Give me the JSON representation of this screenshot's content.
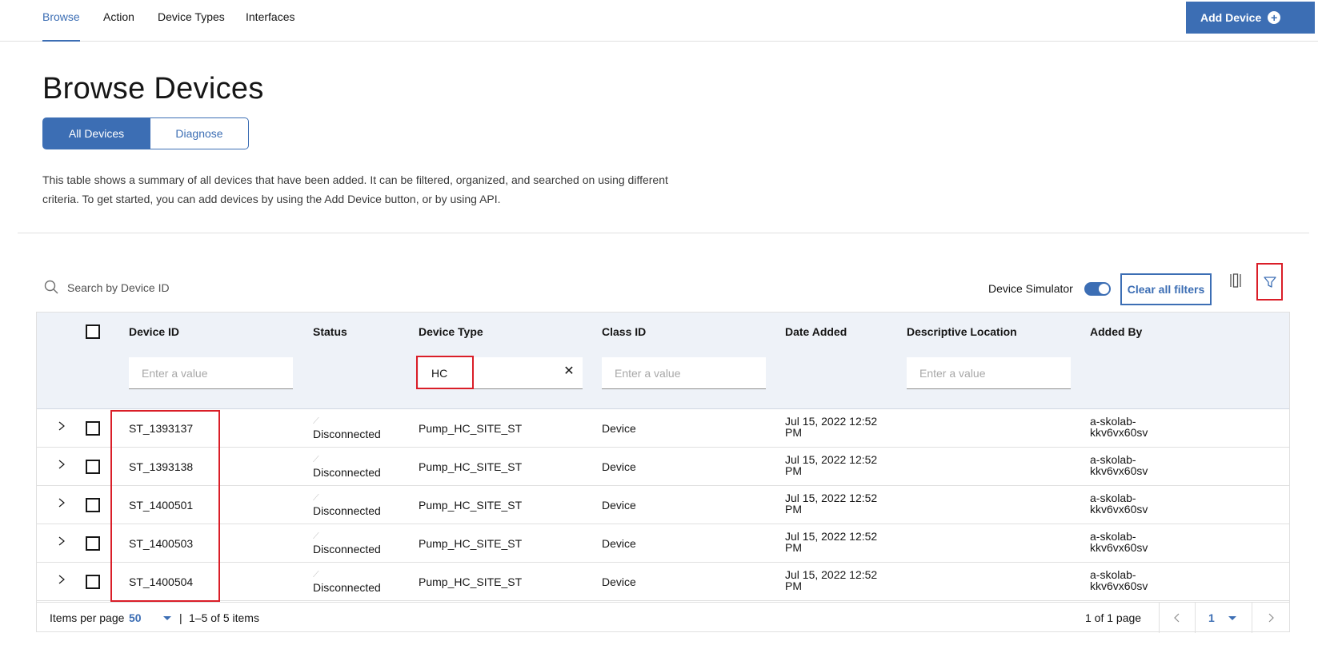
{
  "nav": {
    "tabs": [
      "Browse",
      "Action",
      "Device Types",
      "Interfaces"
    ],
    "add_device_label": "Add Device"
  },
  "page": {
    "title": "Browse Devices",
    "segments": [
      "All Devices",
      "Diagnose"
    ],
    "description": "This table shows a summary of all devices that have been added. It can be filtered, organized, and searched on using different criteria. To get started, you can add devices by using the Add Device button, or by using API."
  },
  "toolbar": {
    "search_placeholder": "Search by Device ID",
    "simulator_label": "Device Simulator",
    "clear_filters_label": "Clear all filters"
  },
  "table": {
    "headers": [
      "Device ID",
      "Status",
      "Device Type",
      "Class ID",
      "Date Added",
      "Descriptive Location",
      "Added By"
    ],
    "filter_placeholder": "Enter a value",
    "device_type_filter_value": "HC",
    "rows": [
      {
        "id": "ST_1393137",
        "status": "Disconnected",
        "type": "Pump_HC_SITE_ST",
        "class": "Device",
        "date_line1": "Jul 15, 2022 12:52",
        "date_line2": "PM",
        "added_line1": "a-skolab-",
        "added_line2": "kkv6vx60sv"
      },
      {
        "id": "ST_1393138",
        "status": "Disconnected",
        "type": "Pump_HC_SITE_ST",
        "class": "Device",
        "date_line1": "Jul 15, 2022 12:52",
        "date_line2": "PM",
        "added_line1": "a-skolab-",
        "added_line2": "kkv6vx60sv"
      },
      {
        "id": "ST_1400501",
        "status": "Disconnected",
        "type": "Pump_HC_SITE_ST",
        "class": "Device",
        "date_line1": "Jul 15, 2022 12:52",
        "date_line2": "PM",
        "added_line1": "a-skolab-",
        "added_line2": "kkv6vx60sv"
      },
      {
        "id": "ST_1400503",
        "status": "Disconnected",
        "type": "Pump_HC_SITE_ST",
        "class": "Device",
        "date_line1": "Jul 15, 2022 12:52",
        "date_line2": "PM",
        "added_line1": "a-skolab-",
        "added_line2": "kkv6vx60sv"
      },
      {
        "id": "ST_1400504",
        "status": "Disconnected",
        "type": "Pump_HC_SITE_ST",
        "class": "Device",
        "date_line1": "Jul 15, 2022 12:52",
        "date_line2": "PM",
        "added_line1": "a-skolab-",
        "added_line2": "kkv6vx60sv"
      }
    ]
  },
  "pagination": {
    "items_per_page_label": "Items per page",
    "items_per_page_value": "50",
    "separator": "|",
    "range_text": "1–5 of 5 items",
    "page_text": "1 of 1 page",
    "current_page": "1"
  },
  "colors": {
    "accent": "#3c6eb4",
    "highlight": "#da1e28"
  },
  "icons": {
    "search": "search-icon",
    "filter": "filter-icon",
    "columns": "column-settings-icon",
    "expand": "chevron-right-icon",
    "add": "add-circle-icon"
  }
}
